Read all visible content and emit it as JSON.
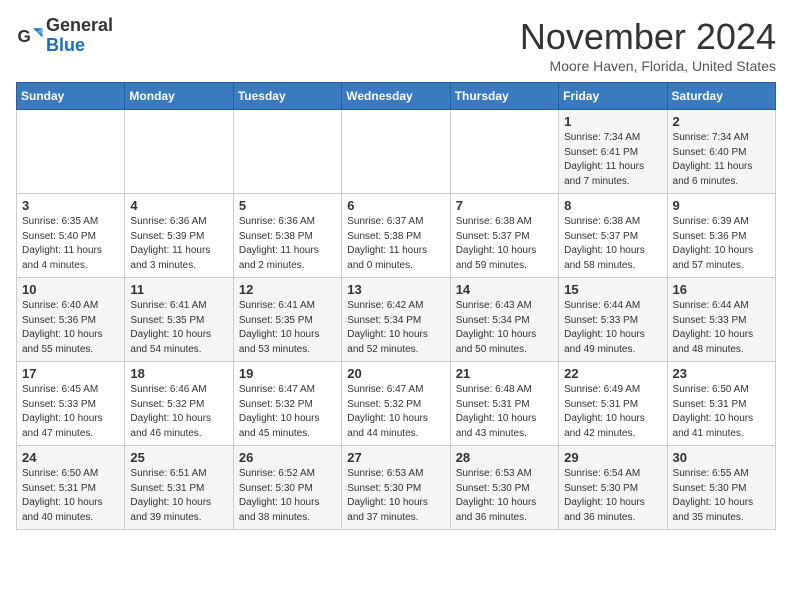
{
  "logo": {
    "general": "General",
    "blue": "Blue"
  },
  "header": {
    "month": "November 2024",
    "location": "Moore Haven, Florida, United States"
  },
  "weekdays": [
    "Sunday",
    "Monday",
    "Tuesday",
    "Wednesday",
    "Thursday",
    "Friday",
    "Saturday"
  ],
  "weeks": [
    [
      {
        "day": "",
        "info": ""
      },
      {
        "day": "",
        "info": ""
      },
      {
        "day": "",
        "info": ""
      },
      {
        "day": "",
        "info": ""
      },
      {
        "day": "",
        "info": ""
      },
      {
        "day": "1",
        "info": "Sunrise: 7:34 AM\nSunset: 6:41 PM\nDaylight: 11 hours and 7 minutes."
      },
      {
        "day": "2",
        "info": "Sunrise: 7:34 AM\nSunset: 6:40 PM\nDaylight: 11 hours and 6 minutes."
      }
    ],
    [
      {
        "day": "3",
        "info": "Sunrise: 6:35 AM\nSunset: 5:40 PM\nDaylight: 11 hours and 4 minutes."
      },
      {
        "day": "4",
        "info": "Sunrise: 6:36 AM\nSunset: 5:39 PM\nDaylight: 11 hours and 3 minutes."
      },
      {
        "day": "5",
        "info": "Sunrise: 6:36 AM\nSunset: 5:38 PM\nDaylight: 11 hours and 2 minutes."
      },
      {
        "day": "6",
        "info": "Sunrise: 6:37 AM\nSunset: 5:38 PM\nDaylight: 11 hours and 0 minutes."
      },
      {
        "day": "7",
        "info": "Sunrise: 6:38 AM\nSunset: 5:37 PM\nDaylight: 10 hours and 59 minutes."
      },
      {
        "day": "8",
        "info": "Sunrise: 6:38 AM\nSunset: 5:37 PM\nDaylight: 10 hours and 58 minutes."
      },
      {
        "day": "9",
        "info": "Sunrise: 6:39 AM\nSunset: 5:36 PM\nDaylight: 10 hours and 57 minutes."
      }
    ],
    [
      {
        "day": "10",
        "info": "Sunrise: 6:40 AM\nSunset: 5:36 PM\nDaylight: 10 hours and 55 minutes."
      },
      {
        "day": "11",
        "info": "Sunrise: 6:41 AM\nSunset: 5:35 PM\nDaylight: 10 hours and 54 minutes."
      },
      {
        "day": "12",
        "info": "Sunrise: 6:41 AM\nSunset: 5:35 PM\nDaylight: 10 hours and 53 minutes."
      },
      {
        "day": "13",
        "info": "Sunrise: 6:42 AM\nSunset: 5:34 PM\nDaylight: 10 hours and 52 minutes."
      },
      {
        "day": "14",
        "info": "Sunrise: 6:43 AM\nSunset: 5:34 PM\nDaylight: 10 hours and 50 minutes."
      },
      {
        "day": "15",
        "info": "Sunrise: 6:44 AM\nSunset: 5:33 PM\nDaylight: 10 hours and 49 minutes."
      },
      {
        "day": "16",
        "info": "Sunrise: 6:44 AM\nSunset: 5:33 PM\nDaylight: 10 hours and 48 minutes."
      }
    ],
    [
      {
        "day": "17",
        "info": "Sunrise: 6:45 AM\nSunset: 5:33 PM\nDaylight: 10 hours and 47 minutes."
      },
      {
        "day": "18",
        "info": "Sunrise: 6:46 AM\nSunset: 5:32 PM\nDaylight: 10 hours and 46 minutes."
      },
      {
        "day": "19",
        "info": "Sunrise: 6:47 AM\nSunset: 5:32 PM\nDaylight: 10 hours and 45 minutes."
      },
      {
        "day": "20",
        "info": "Sunrise: 6:47 AM\nSunset: 5:32 PM\nDaylight: 10 hours and 44 minutes."
      },
      {
        "day": "21",
        "info": "Sunrise: 6:48 AM\nSunset: 5:31 PM\nDaylight: 10 hours and 43 minutes."
      },
      {
        "day": "22",
        "info": "Sunrise: 6:49 AM\nSunset: 5:31 PM\nDaylight: 10 hours and 42 minutes."
      },
      {
        "day": "23",
        "info": "Sunrise: 6:50 AM\nSunset: 5:31 PM\nDaylight: 10 hours and 41 minutes."
      }
    ],
    [
      {
        "day": "24",
        "info": "Sunrise: 6:50 AM\nSunset: 5:31 PM\nDaylight: 10 hours and 40 minutes."
      },
      {
        "day": "25",
        "info": "Sunrise: 6:51 AM\nSunset: 5:31 PM\nDaylight: 10 hours and 39 minutes."
      },
      {
        "day": "26",
        "info": "Sunrise: 6:52 AM\nSunset: 5:30 PM\nDaylight: 10 hours and 38 minutes."
      },
      {
        "day": "27",
        "info": "Sunrise: 6:53 AM\nSunset: 5:30 PM\nDaylight: 10 hours and 37 minutes."
      },
      {
        "day": "28",
        "info": "Sunrise: 6:53 AM\nSunset: 5:30 PM\nDaylight: 10 hours and 36 minutes."
      },
      {
        "day": "29",
        "info": "Sunrise: 6:54 AM\nSunset: 5:30 PM\nDaylight: 10 hours and 36 minutes."
      },
      {
        "day": "30",
        "info": "Sunrise: 6:55 AM\nSunset: 5:30 PM\nDaylight: 10 hours and 35 minutes."
      }
    ]
  ]
}
